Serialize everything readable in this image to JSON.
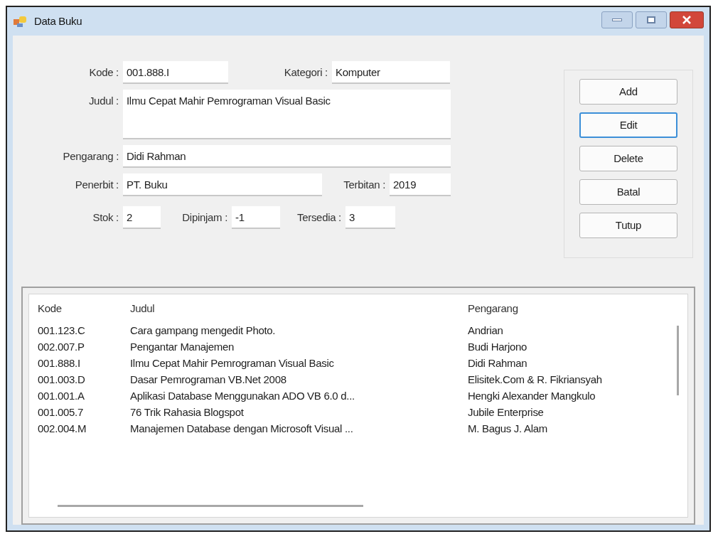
{
  "window": {
    "title": "Data Buku"
  },
  "fields": [
    {
      "label": "Kode :",
      "value": "001.888.I"
    },
    {
      "label": "Kategori :",
      "value": "Komputer"
    },
    {
      "label": "Judul :",
      "value": "Ilmu Cepat Mahir Pemrograman Visual Basic"
    },
    {
      "label": "Pengarang :",
      "value": "Didi Rahman"
    },
    {
      "label": "Penerbit :",
      "value": "PT. Buku"
    },
    {
      "label": "Terbitan :",
      "value": "2019"
    },
    {
      "label": "Stok :",
      "value": "2"
    },
    {
      "label": "Dipinjam :",
      "value": "-1"
    },
    {
      "label": "Tersedia :",
      "value": "3"
    }
  ],
  "buttons": [
    {
      "label": "Add",
      "focused": false
    },
    {
      "label": "Edit",
      "focused": true
    },
    {
      "label": "Delete",
      "focused": false
    },
    {
      "label": "Batal",
      "focused": false
    },
    {
      "label": "Tutup",
      "focused": false
    }
  ],
  "table": {
    "columns": [
      "Kode",
      "Judul",
      "Pengarang"
    ],
    "rows": [
      [
        "001.123.C",
        "Cara gampang mengedit Photo.",
        "Andrian"
      ],
      [
        "002.007.P",
        "Pengantar Manajemen",
        "Budi Harjono"
      ],
      [
        "001.888.I",
        "Ilmu Cepat Mahir Pemrograman Visual Basic",
        "Didi Rahman"
      ],
      [
        "001.003.D",
        "Dasar Pemrograman VB.Net 2008",
        "Elisitek.Com & R. Fikriansyah"
      ],
      [
        "001.001.A",
        "Aplikasi Database Menggunakan ADO VB 6.0 d...",
        "Hengki Alexander Mangkulo"
      ],
      [
        "001.005.7",
        "76 Trik Rahasia Blogspot",
        "Jubile Enterprise"
      ],
      [
        "002.004.M",
        "Manajemen Database dengan Microsoft Visual ...",
        "M. Bagus J. Alam"
      ]
    ]
  }
}
